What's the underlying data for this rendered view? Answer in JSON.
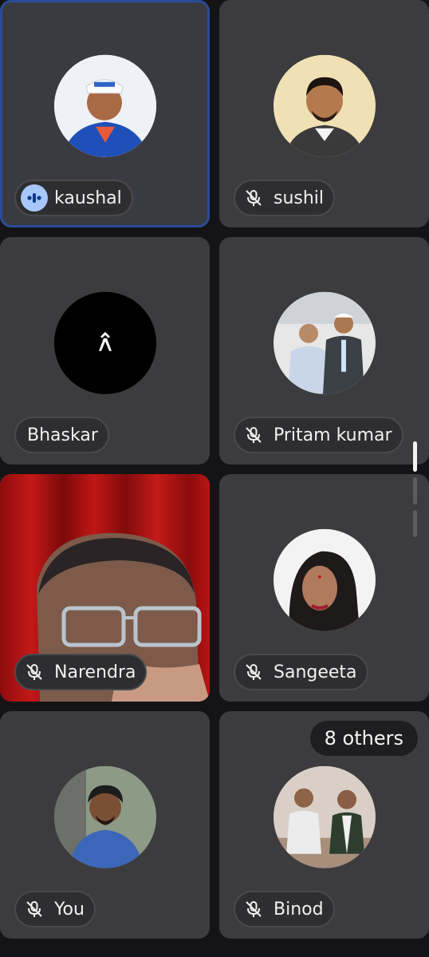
{
  "participants": [
    {
      "name": "kaushal",
      "status": "speaking"
    },
    {
      "name": "sushil",
      "status": "muted"
    },
    {
      "name": "Bhaskar",
      "status": "none"
    },
    {
      "name": "Pritam kumar",
      "status": "muted"
    },
    {
      "name": "Narendra",
      "status": "muted"
    },
    {
      "name": "Sangeeta",
      "status": "muted"
    },
    {
      "name": "You",
      "status": "muted"
    },
    {
      "name": "Binod",
      "status": "muted"
    }
  ],
  "others_badge": "8 others",
  "colors": {
    "tile": "#3c3c3f",
    "speaking_outline": "#2b4b9a",
    "speaking_icon_bg": "#a8c7fa",
    "nameplate_bg": "#2e2e31"
  },
  "icons": [
    "speaking-indicator-icon",
    "mic-off-icon",
    "logo-icon"
  ]
}
